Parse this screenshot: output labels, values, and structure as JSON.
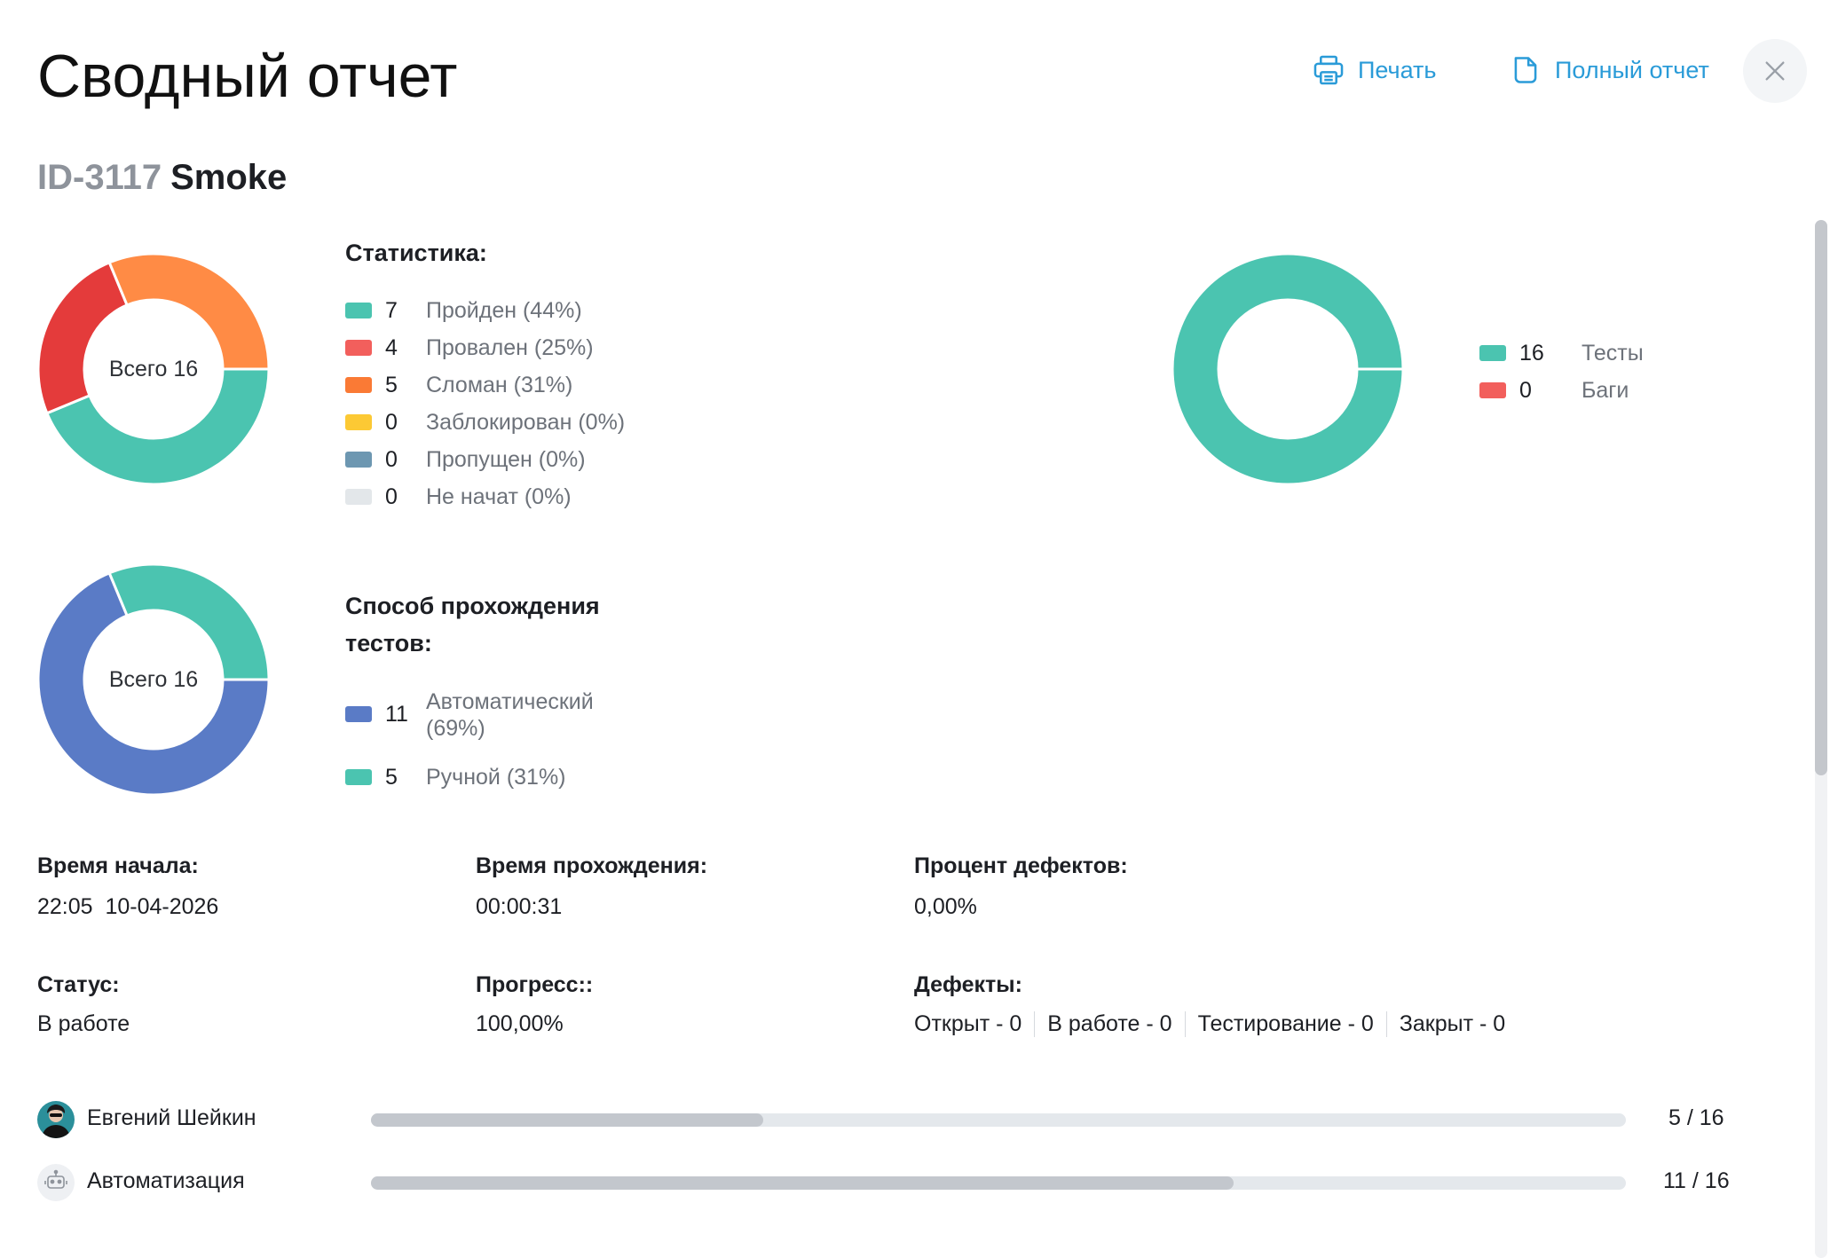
{
  "header": {
    "title": "Сводный отчет",
    "print_label": "Печать",
    "full_report_label": "Полный отчет"
  },
  "run": {
    "id": "ID-3117",
    "name": "Smoke"
  },
  "statistics": {
    "title": "Статистика:",
    "center_label": "Всего 16",
    "items": [
      {
        "count": "7",
        "label": "Пройден (44%)",
        "color": "#4bc4b0"
      },
      {
        "count": "4",
        "label": "Провален (25%)",
        "color": "#f25f5c"
      },
      {
        "count": "5",
        "label": "Сломан (31%)",
        "color": "#fa7a35"
      },
      {
        "count": "0",
        "label": "Заблокирован (0%)",
        "color": "#fcc934"
      },
      {
        "count": "0",
        "label": "Пропущен (0%)",
        "color": "#6d97b1"
      },
      {
        "count": "0",
        "label": "Не начат (0%)",
        "color": "#e3e7ea"
      }
    ]
  },
  "tests_bugs": {
    "items": [
      {
        "count": "16",
        "label": "Тесты",
        "color": "#4bc4b0"
      },
      {
        "count": "0",
        "label": "Баги",
        "color": "#f25f5c"
      }
    ]
  },
  "method": {
    "title_line1": "Способ прохождения",
    "title_line2": "тестов:",
    "center_label": "Всего 16",
    "items": [
      {
        "count": "11",
        "label_line1": "Автоматический",
        "label_line2": "(69%)",
        "color": "#5a7bc6"
      },
      {
        "count": "5",
        "label": "Ручной (31%)",
        "color": "#4bc4b0"
      }
    ]
  },
  "chart_data": [
    {
      "type": "pie",
      "title": "Статистика:",
      "center_label": "Всего 16",
      "categories": [
        "Пройден",
        "Провален",
        "Сломан",
        "Заблокирован",
        "Пропущен",
        "Не начат"
      ],
      "values": [
        7,
        4,
        5,
        0,
        0,
        0
      ],
      "colors": [
        "#4bc4b0",
        "#e43b3b",
        "#ff8b45",
        "#fcc934",
        "#6d97b1",
        "#e3e7ea"
      ]
    },
    {
      "type": "pie",
      "categories": [
        "Тесты",
        "Баги"
      ],
      "values": [
        16,
        0
      ],
      "colors": [
        "#4bc4b0",
        "#f25f5c"
      ]
    },
    {
      "type": "pie",
      "title": "Способ прохождения тестов:",
      "center_label": "Всего 16",
      "categories": [
        "Автоматический",
        "Ручной"
      ],
      "values": [
        11,
        5
      ],
      "colors": [
        "#5a7bc6",
        "#4bc4b0"
      ]
    }
  ],
  "info": {
    "start_time_label": "Время начала:",
    "start_time_value": "22:05  10-04-2026",
    "duration_label": "Время прохождения:",
    "duration_value": "00:00:31",
    "defect_pct_label": "Процент дефектов:",
    "defect_pct_value": "0,00%",
    "status_label": "Статус:",
    "status_value": "В работе",
    "progress_label": "Прогресс::",
    "progress_value": "100,00%",
    "defects_label": "Дефекты:",
    "defects": [
      "Открыт - 0",
      "В работе - 0",
      "Тестирование - 0",
      "Закрыт - 0"
    ]
  },
  "assignees": [
    {
      "name": "Евгений Шейкин",
      "done": 5,
      "total": 16,
      "count_text": "5 / 16",
      "avatar": "person-avatar"
    },
    {
      "name": "Автоматизация",
      "done": 11,
      "total": 16,
      "count_text": "11 / 16",
      "avatar": "robot-icon"
    }
  ]
}
